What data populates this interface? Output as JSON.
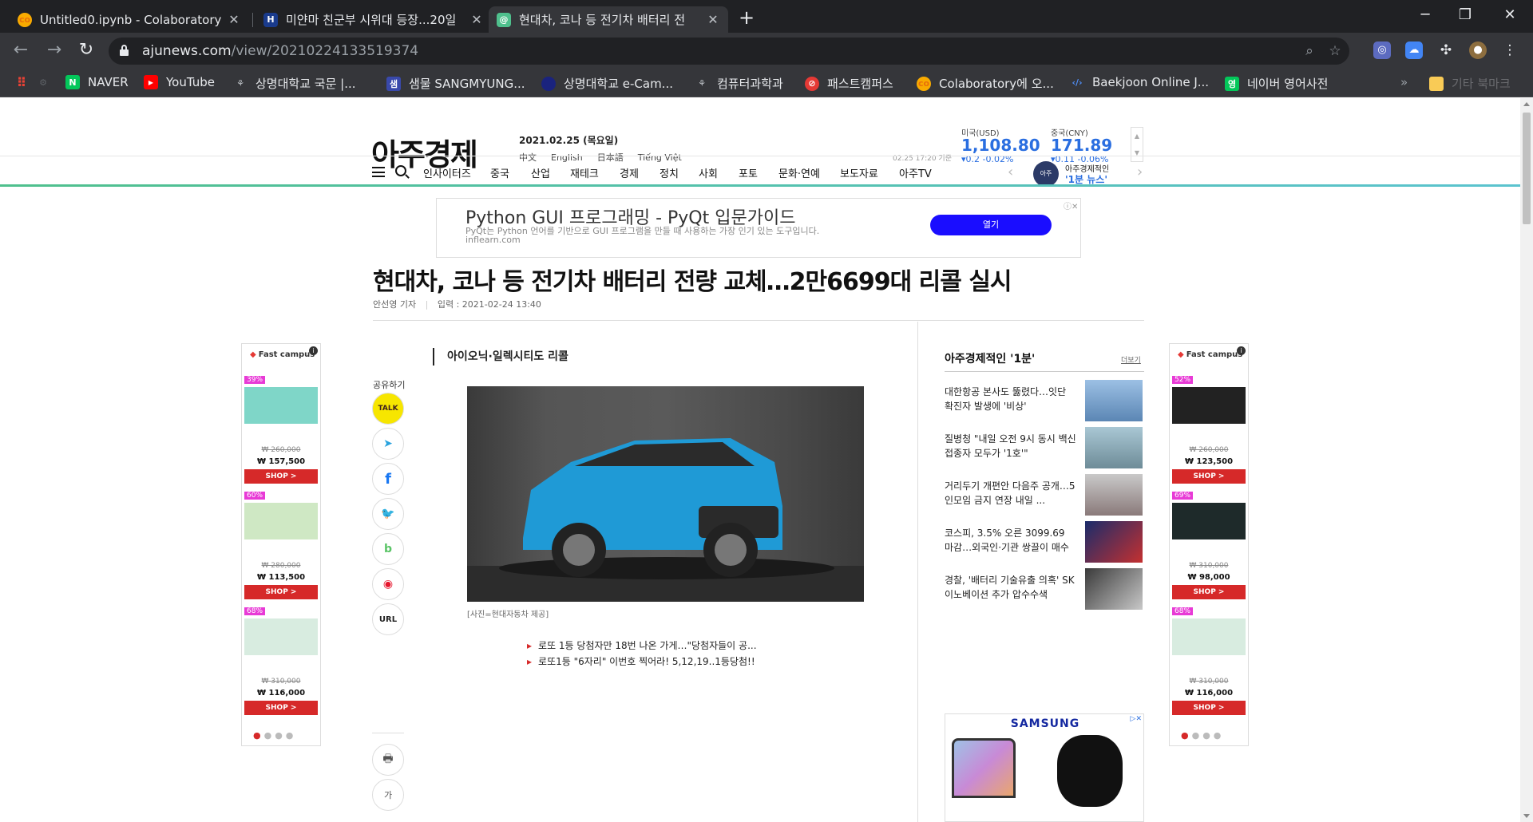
{
  "browser": {
    "tabs": [
      {
        "title": "Untitled0.ipynb - Colaboratory",
        "icon": "colab-icon",
        "active": false
      },
      {
        "title": "미얀마 친군부 시위대 등장...20일",
        "icon": "h-icon",
        "active": false
      },
      {
        "title": "현대차, 코나 등 전기차 배터리 전",
        "icon": "ajunews-icon",
        "active": true
      }
    ],
    "url_host": "ajunews.com",
    "url_path": "/view/20210224133519374",
    "bookmarks": [
      {
        "label": "NAVER",
        "color": "#03c75a",
        "letter": "N"
      },
      {
        "label": "YouTube",
        "color": "#ff0000",
        "letter": "▶"
      },
      {
        "label": "상명대학교 국문 |...",
        "color": "#5f6368",
        "letter": "⚘"
      },
      {
        "label": "샘물 SANGMYUNG...",
        "color": "#3949ab",
        "letter": "샘"
      },
      {
        "label": "상명대학교 e-Cam...",
        "color": "#1a237e",
        "letter": "●"
      },
      {
        "label": "컴퓨터과학과",
        "color": "#5f6368",
        "letter": "⚘"
      },
      {
        "label": "패스트캠퍼스",
        "color": "#e53935",
        "letter": "⊘"
      },
      {
        "label": "Colaboratory에 오...",
        "color": "#f9ab00",
        "letter": "co"
      },
      {
        "label": "Baekjoon Online J...",
        "color": "#35363a",
        "letter": "‹›"
      },
      {
        "label": "네이버 영어사전",
        "color": "#03c75a",
        "letter": "영"
      }
    ],
    "bookmarks_more": "»",
    "other_bookmarks": "기타 북마크"
  },
  "site": {
    "logo": "아주경제",
    "date": "2021.02.25 (목요일)",
    "languages": [
      "中文",
      "English",
      "日本語",
      "Tiếng Việt"
    ],
    "fx": [
      {
        "label": "미국(USD)",
        "value": "1,108.80",
        "change": "▾0.2  -0.02%"
      },
      {
        "label": "중국(CNY)",
        "value": "171.89",
        "change": "▾0.11  -0.06%"
      }
    ],
    "fx_time": "02.25 17:20 기준",
    "nav": [
      "인사이터즈",
      "중국",
      "산업",
      "재테크",
      "경제",
      "정치",
      "사회",
      "포토",
      "문화·연예",
      "보도자료",
      "아주TV"
    ],
    "nav_banner_line1": "아주경제적인",
    "nav_banner_line2": "'1분 뉴스'",
    "nav_banner_badge": "아주"
  },
  "ad": {
    "headline": "Python GUI 프로그래밍 - PyQt 입문가이드",
    "desc": "PyQt는 Python 언어를 기반으로 GUI 프로그램을 만들 때 사용하는 가장 인기 있는 도구입니다.",
    "source": "inflearn.com",
    "button": "열기",
    "close": "ⓘ✕"
  },
  "article": {
    "headline": "현대차, 코나 등 전기차 배터리 전량 교체…2만6699대 리콜 실시",
    "reporter": "안선영 기자",
    "input_time": "입력 : 2021-02-24 13:40",
    "subhead": "아이오닉·일렉시티도 리콜",
    "caption": "[사진=현대자동차 제공]",
    "related": [
      "로또 1등 당첨자만 18번 나온 가게…\"당첨자들이 공...",
      "로또1등 \"6자리\" 이번호 찍어라! 5,12,19..1등당첨!!"
    ]
  },
  "share": {
    "label": "공유하기",
    "buttons": [
      {
        "name": "kakaotalk",
        "text": "TALK"
      },
      {
        "name": "telegram",
        "text": "➤"
      },
      {
        "name": "facebook",
        "text": "f"
      },
      {
        "name": "twitter",
        "text": "🐦"
      },
      {
        "name": "band",
        "text": "b"
      },
      {
        "name": "weibo",
        "text": "◉"
      },
      {
        "name": "url",
        "text": "URL"
      },
      {
        "name": "print",
        "text": "🖶"
      },
      {
        "name": "font-size",
        "text": "가"
      }
    ]
  },
  "sidebar": {
    "title": "아주경제적인 '1분'",
    "more": "더보기",
    "items": [
      "대한항공 본사도 뚫렸다…잇단 확진자 발생에 '비상'",
      "질병청 \"내일 오전 9시 동시 백신 접종자 모두가 '1호'\"",
      "거리두기 개편안 다음주 공개…5인모임 금지 연장 내일 ...",
      "코스피, 3.5% 오른 3099.69 마감…외국인·기관 쌍끌이 매수",
      "경찰, '배터리 기술유출 의혹' SK이노베이션 추가 압수수색"
    ],
    "samsung": "SAMSUNG"
  },
  "fastcampus_left": {
    "brand": "Fast campus",
    "items": [
      {
        "pct": "39%",
        "old": "₩ 260,000",
        "price": "₩ 157,500",
        "shop": "SHOP >",
        "thumb_color": "#7fd6c8"
      },
      {
        "pct": "60%",
        "old": "₩ 280,000",
        "price": "₩ 113,500",
        "shop": "SHOP >",
        "thumb_color": "#cfe8c4"
      },
      {
        "pct": "68%",
        "old": "₩ 310,000",
        "price": "₩ 116,000",
        "shop": "SHOP >",
        "thumb_color": "#d8ece0"
      }
    ]
  },
  "fastcampus_right": {
    "brand": "Fast campus",
    "items": [
      {
        "pct": "52%",
        "old": "₩ 260,000",
        "price": "₩ 123,500",
        "shop": "SHOP >",
        "thumb_color": "#222"
      },
      {
        "pct": "69%",
        "old": "₩ 310,000",
        "price": "₩ 98,000",
        "shop": "SHOP >",
        "thumb_color": "#1e2a2a"
      },
      {
        "pct": "68%",
        "old": "₩ 310,000",
        "price": "₩ 116,000",
        "shop": "SHOP >",
        "thumb_color": "#d8ece0"
      }
    ]
  },
  "colors": {
    "accent_blue": "#2a6ee0",
    "shop_red": "#d62929",
    "chrome_dark": "#202124"
  }
}
